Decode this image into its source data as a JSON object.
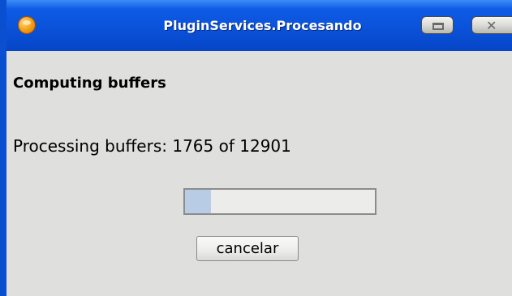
{
  "window": {
    "title": "PluginServices.Procesando",
    "icon": "plugin-app-icon",
    "controls": {
      "minimize_icon": "minimize-icon",
      "close_icon": "close-icon",
      "close_glyph": "✕"
    }
  },
  "dialog": {
    "heading": "Computing buffers",
    "status": "Processing buffers: 1765 of 12901",
    "progress": {
      "current": 1765,
      "total": 12901,
      "fraction": 0.1368
    },
    "cancel_label": "cancelar"
  },
  "colors": {
    "titlebar": "#0a52d9",
    "window_bg": "#dfdfdd",
    "progress_fill": "#b9cce6"
  }
}
